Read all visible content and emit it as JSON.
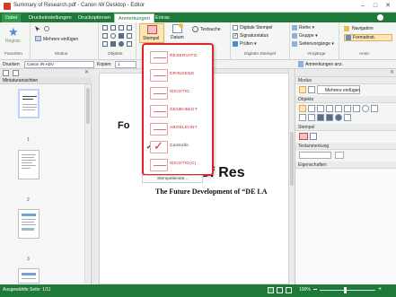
{
  "window": {
    "title": "Summary of Research.pdf - Canon iW Desktop - Editor",
    "controls": [
      "–",
      "□",
      "✕"
    ]
  },
  "ribbon_tabs": [
    {
      "label": "Datei",
      "active": false,
      "file": true
    },
    {
      "label": "Druckeinstellungen",
      "active": false
    },
    {
      "label": "Druckoptionen",
      "active": false
    },
    {
      "label": "Anmerkungen",
      "active": true
    },
    {
      "label": "Extras",
      "active": false
    }
  ],
  "ribbon": {
    "favoriten_label": "Favoriten",
    "regists_label": "Regists",
    "modus_label": "Modus",
    "mehrere_einfuegen": "Mehrere einfügen",
    "objekte_label": "Objekte",
    "stempel_label": "Stempel",
    "datum_label": "Datum",
    "textsuche_label": "Textsuche",
    "digitale_stempel": "Digitale Stempel",
    "signaturstatus": "Signaturstatus",
    "pruefen": "Prüfen ▾",
    "digitale_stempel_group": "Digitale Stempel",
    "reihe": "Reihe ▾",
    "gruppe": "Gruppe ▾",
    "seitenvorgaenge": "Seitenvorgänge ▾",
    "vorgaenge_label": "Vorgänge",
    "navigation": "Navigation",
    "formatinst": "Formatinst.",
    "ansicht_label": "Ansic"
  },
  "toolbar2": {
    "drucken_label": "Drucken",
    "printer_value": "Canon iR-ADV",
    "kopien_label": "Kopien",
    "kopien_value": "1",
    "anmerkungen_anz": "Anmerkungen anz."
  },
  "left_pane": {
    "header": "Miniaturansichten",
    "pages": [
      "1",
      "2",
      "3",
      "4"
    ]
  },
  "document": {
    "fragment_text": "Fo",
    "fragment_text2": "o",
    "title_fragment": "mary of Res",
    "subtitle_fragment": "The Future Development of “DE LA",
    "gear": "⚙"
  },
  "stamp_menu": {
    "items": [
      {
        "label": "RESERVATO",
        "checked": false
      },
      {
        "label": "DRINGEND",
        "checked": false
      },
      {
        "label": "WICHTIG",
        "checked": false
      },
      {
        "label": "GENEHMIGT",
        "checked": false
      },
      {
        "label": "ABGELEHNT",
        "checked": false
      },
      {
        "label": "Controllo",
        "checked": true
      },
      {
        "label": "WICHTIG(C)",
        "checked": false
      }
    ],
    "footer": "Stempeleinste..."
  },
  "right_pane": {
    "modus": "Modus",
    "mehrere_einfuegen": "Mehrere einfügen",
    "objekte": "Objekte",
    "stempel": "Stempel",
    "textanmerkung": "Textanmerkung",
    "eigenschaften": "Eigenschaften"
  },
  "status": {
    "left": "Ausgewählte Seite: 1/11",
    "zoom": "100%"
  },
  "colors": {
    "brand_green": "#1f7a3a",
    "highlight_red": "#e0232a",
    "stamp_red": "#c4262c"
  }
}
